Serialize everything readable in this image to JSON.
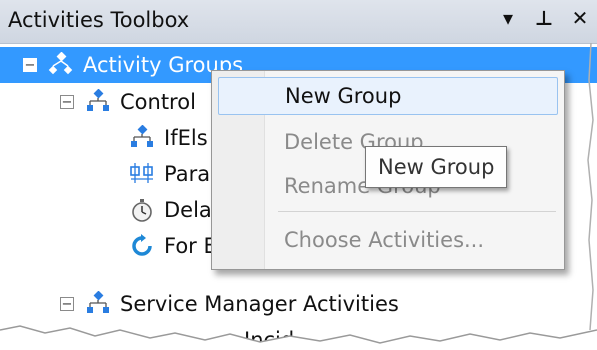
{
  "window": {
    "title": "Activities Toolbox",
    "controls": {
      "dropdown_icon": "▾",
      "pin_icon": "⊥",
      "close_icon": "✕"
    }
  },
  "tree": {
    "root": {
      "expander": "−",
      "label": "Activity Groups"
    },
    "control": {
      "expander": "−",
      "label": "Control"
    },
    "items": [
      {
        "label": "IfEls"
      },
      {
        "label": "Para"
      },
      {
        "label": "Dela"
      },
      {
        "label": "For Each Loop"
      }
    ],
    "service_manager": {
      "expander": "−",
      "label": "Service Manager Activities"
    },
    "partial": {
      "label": "Incid"
    }
  },
  "context_menu": {
    "items": [
      {
        "label": "New Group",
        "state": "active"
      },
      {
        "label": "Delete Group",
        "state": "disabled"
      },
      {
        "label": "Rename Group",
        "state": "disabled"
      },
      {
        "label": "Choose Activities...",
        "state": "disabled"
      }
    ]
  },
  "tooltip": {
    "text": "New Group"
  },
  "colors": {
    "selection": "#3399ff",
    "menu_bg": "#f5f5f5",
    "menu_hover": "#e9f2fd",
    "disabled_text": "#8a8a8a",
    "icon_blue": "#2a7de1"
  }
}
